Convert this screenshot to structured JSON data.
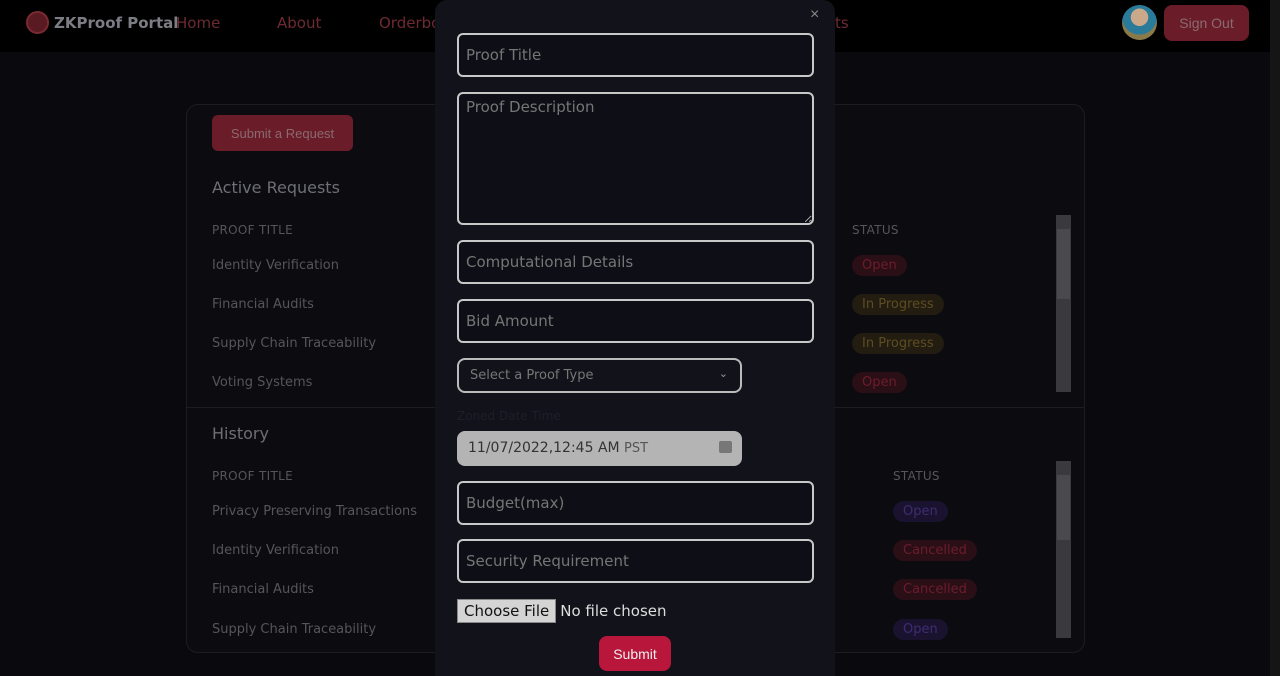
{
  "header": {
    "brand": "ZKProof Portal",
    "nav": [
      "Home",
      "About",
      "Orderbook",
      "Requests"
    ],
    "sign_out": "Sign Out"
  },
  "card": {
    "submit_request": "Submit a Request",
    "active": {
      "title": "Active Requests",
      "col_title": "PROOF TITLE",
      "col_status": "STATUS",
      "rows": [
        {
          "title": "Identity Verification",
          "status": "Open"
        },
        {
          "title": "Financial Audits",
          "status": "In Progress"
        },
        {
          "title": "Supply Chain Traceability",
          "status": "In Progress"
        },
        {
          "title": "Voting Systems",
          "status": "Open"
        }
      ]
    },
    "history": {
      "title": "History",
      "col_title": "PROOF TITLE",
      "col_status": "STATUS",
      "rows": [
        {
          "title": "Privacy Preserving Transactions",
          "status": "Open"
        },
        {
          "title": "Identity Verification",
          "status": "Cancelled"
        },
        {
          "title": "Financial Audits",
          "status": "Cancelled"
        },
        {
          "title": "Supply Chain Traceability",
          "status": "Open"
        }
      ]
    }
  },
  "modal": {
    "close": "×",
    "proof_title": "Proof Title",
    "proof_description": "Proof Description",
    "computational_details": "Computational Details",
    "bid_amount": "Bid Amount",
    "proof_type": "Select a Proof Type",
    "zoned_label": "Zoned Date Time",
    "date_value": "11/07/2022,12:45 AM",
    "timezone": "PST",
    "budget": "Budget(max)",
    "security": "Security Requirement",
    "choose_file": "Choose File",
    "no_file": "No file chosen",
    "submit": "Submit"
  },
  "colors": {
    "accent": "#b8163a",
    "open": "#6e1c2c",
    "in_progress": "#5e4c22"
  }
}
